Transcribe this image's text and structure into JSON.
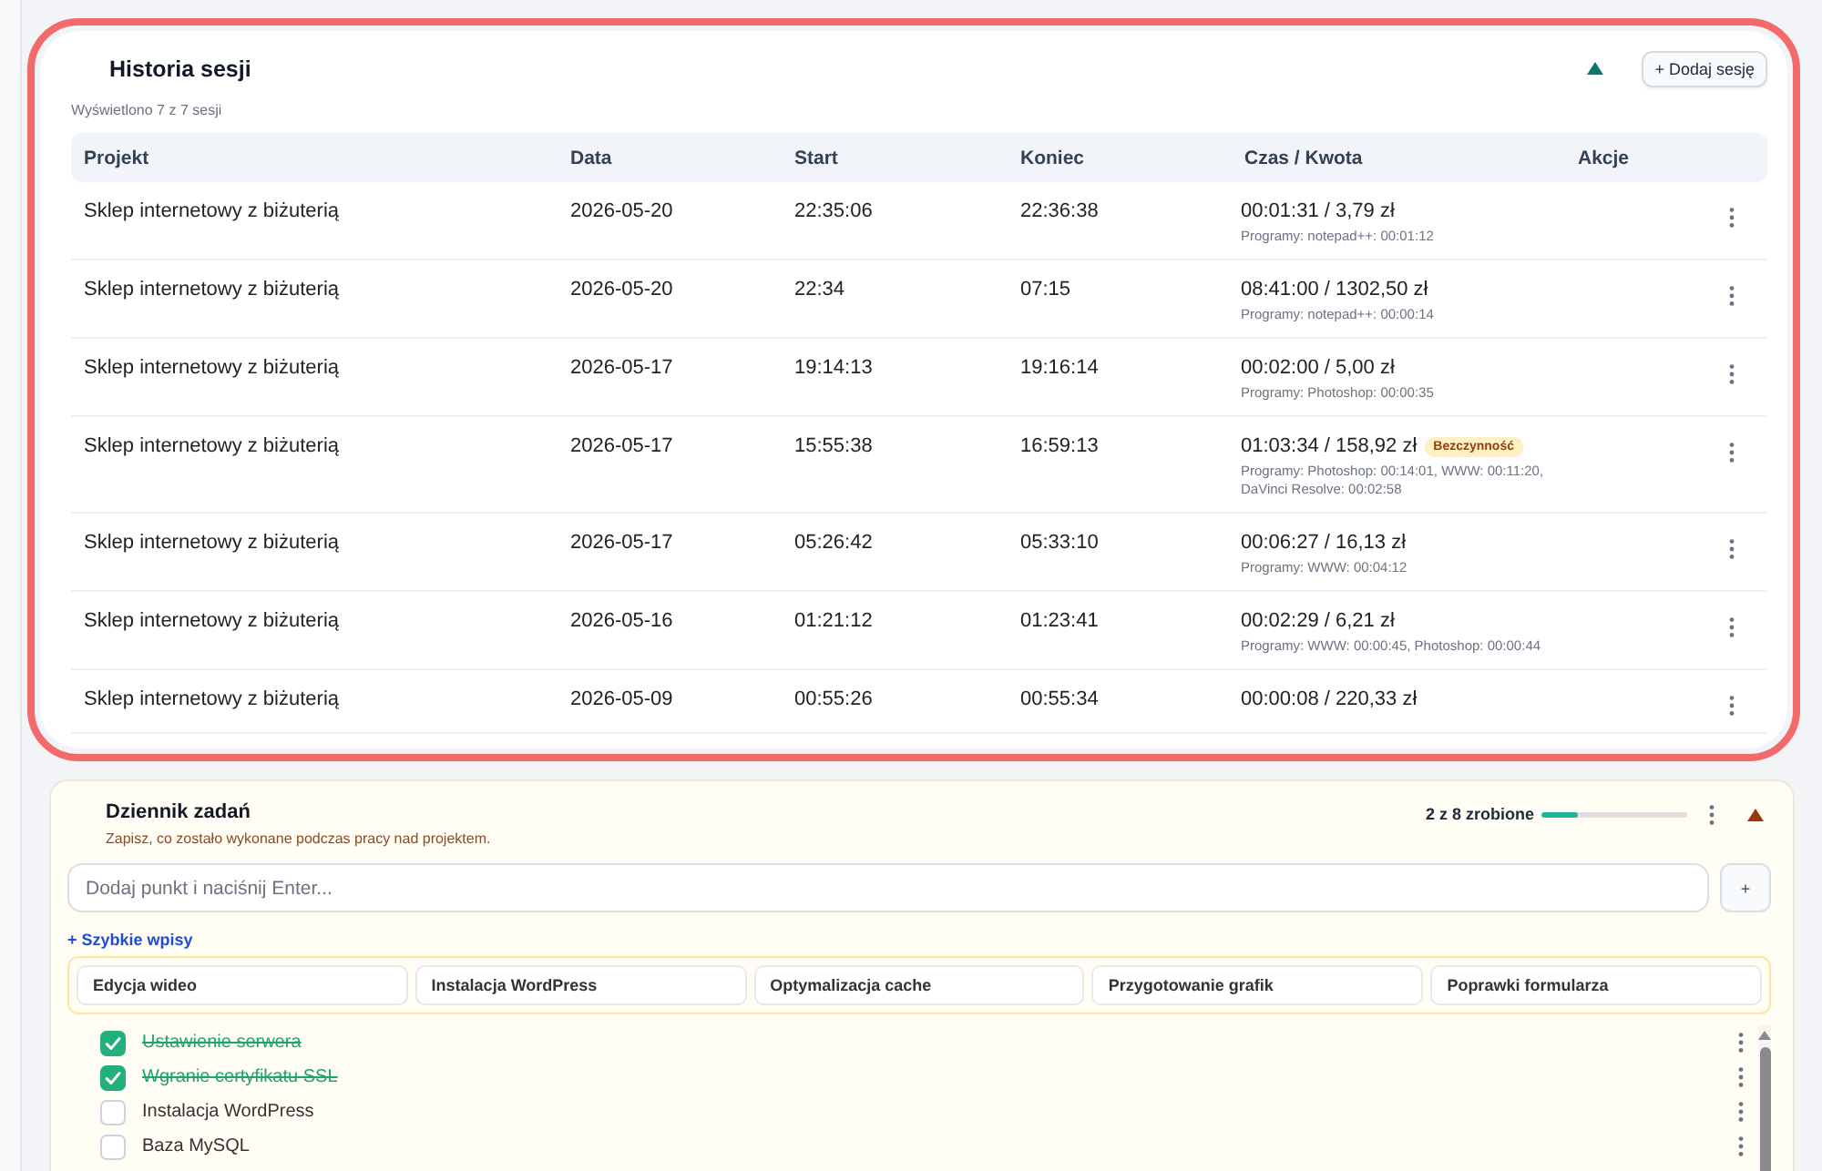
{
  "sessions_panel": {
    "highlighted": true,
    "title": "Historia sesji",
    "subtitle": "Wyświetlono 7 z 7 sesji",
    "expanded": true,
    "add_button": "+ Dodaj sesję",
    "table": {
      "columns": [
        "Projekt",
        "Data",
        "Start",
        "Koniec",
        "Czas / Kwota",
        "Akcje"
      ],
      "rows": [
        {
          "project": "Sklep internetowy z biżuterią",
          "date": "2026-05-20",
          "start": "22:35:06",
          "end": "22:36:38",
          "time_amount": "00:01:31 / 3,79 zł",
          "programs": "Programy: notepad++: 00:01:12"
        },
        {
          "project": "Sklep internetowy z biżuterią",
          "date": "2026-05-20",
          "start": "22:34",
          "end": "07:15",
          "time_amount": "08:41:00 / 1302,50 zł",
          "programs": "Programy: notepad++: 00:00:14"
        },
        {
          "project": "Sklep internetowy z biżuterią",
          "date": "2026-05-17",
          "start": "19:14:13",
          "end": "19:16:14",
          "time_amount": "00:02:00 / 5,00 zł",
          "programs": "Programy: Photoshop: 00:00:35"
        },
        {
          "project": "Sklep internetowy z biżuterią",
          "date": "2026-05-17",
          "start": "15:55:38",
          "end": "16:59:13",
          "time_amount": "01:03:34 / 158,92 zł",
          "badge": "Bezczynność",
          "programs": "Programy: Photoshop: 00:14:01, WWW: 00:11:20, DaVinci Resolve: 00:02:58"
        },
        {
          "project": "Sklep internetowy z biżuterią",
          "date": "2026-05-17",
          "start": "05:26:42",
          "end": "05:33:10",
          "time_amount": "00:06:27 / 16,13 zł",
          "programs": "Programy: WWW: 00:04:12"
        },
        {
          "project": "Sklep internetowy z biżuterią",
          "date": "2026-05-16",
          "start": "01:21:12",
          "end": "01:23:41",
          "time_amount": "00:02:29 / 6,21 zł",
          "programs": "Programy: WWW: 00:00:45, Photoshop: 00:00:44"
        },
        {
          "project": "Sklep internetowy z biżuterią",
          "date": "2026-05-09",
          "start": "00:55:26",
          "end": "00:55:34",
          "time_amount": "00:00:08 / 220,33 zł"
        }
      ]
    }
  },
  "tasks_panel": {
    "title": "Dziennik zadań",
    "description": "Zapisz, co zostało wykonane podczas pracy nad projektem.",
    "progress_label": "2 z 8 zrobione",
    "level": 0.25,
    "expanded": true,
    "input": {
      "placeholder": "Dodaj punkt i naciśnij Enter..."
    },
    "add_button": "+",
    "quick_toggle": "+ Szybkie wpisy",
    "quick_entries": [
      "Edycja wideo",
      "Instalacja WordPress",
      "Optymalizacja cache",
      "Przygotowanie grafik",
      "Poprawki formularza"
    ],
    "items": [
      {
        "label": "Ustawienie serwera",
        "checked": true
      },
      {
        "label": "Wgranie certyfikatu SSL",
        "checked": true
      },
      {
        "label": "Instalacja WordPress",
        "checked": false
      },
      {
        "label": "Baza MySQL",
        "checked": false
      }
    ]
  }
}
